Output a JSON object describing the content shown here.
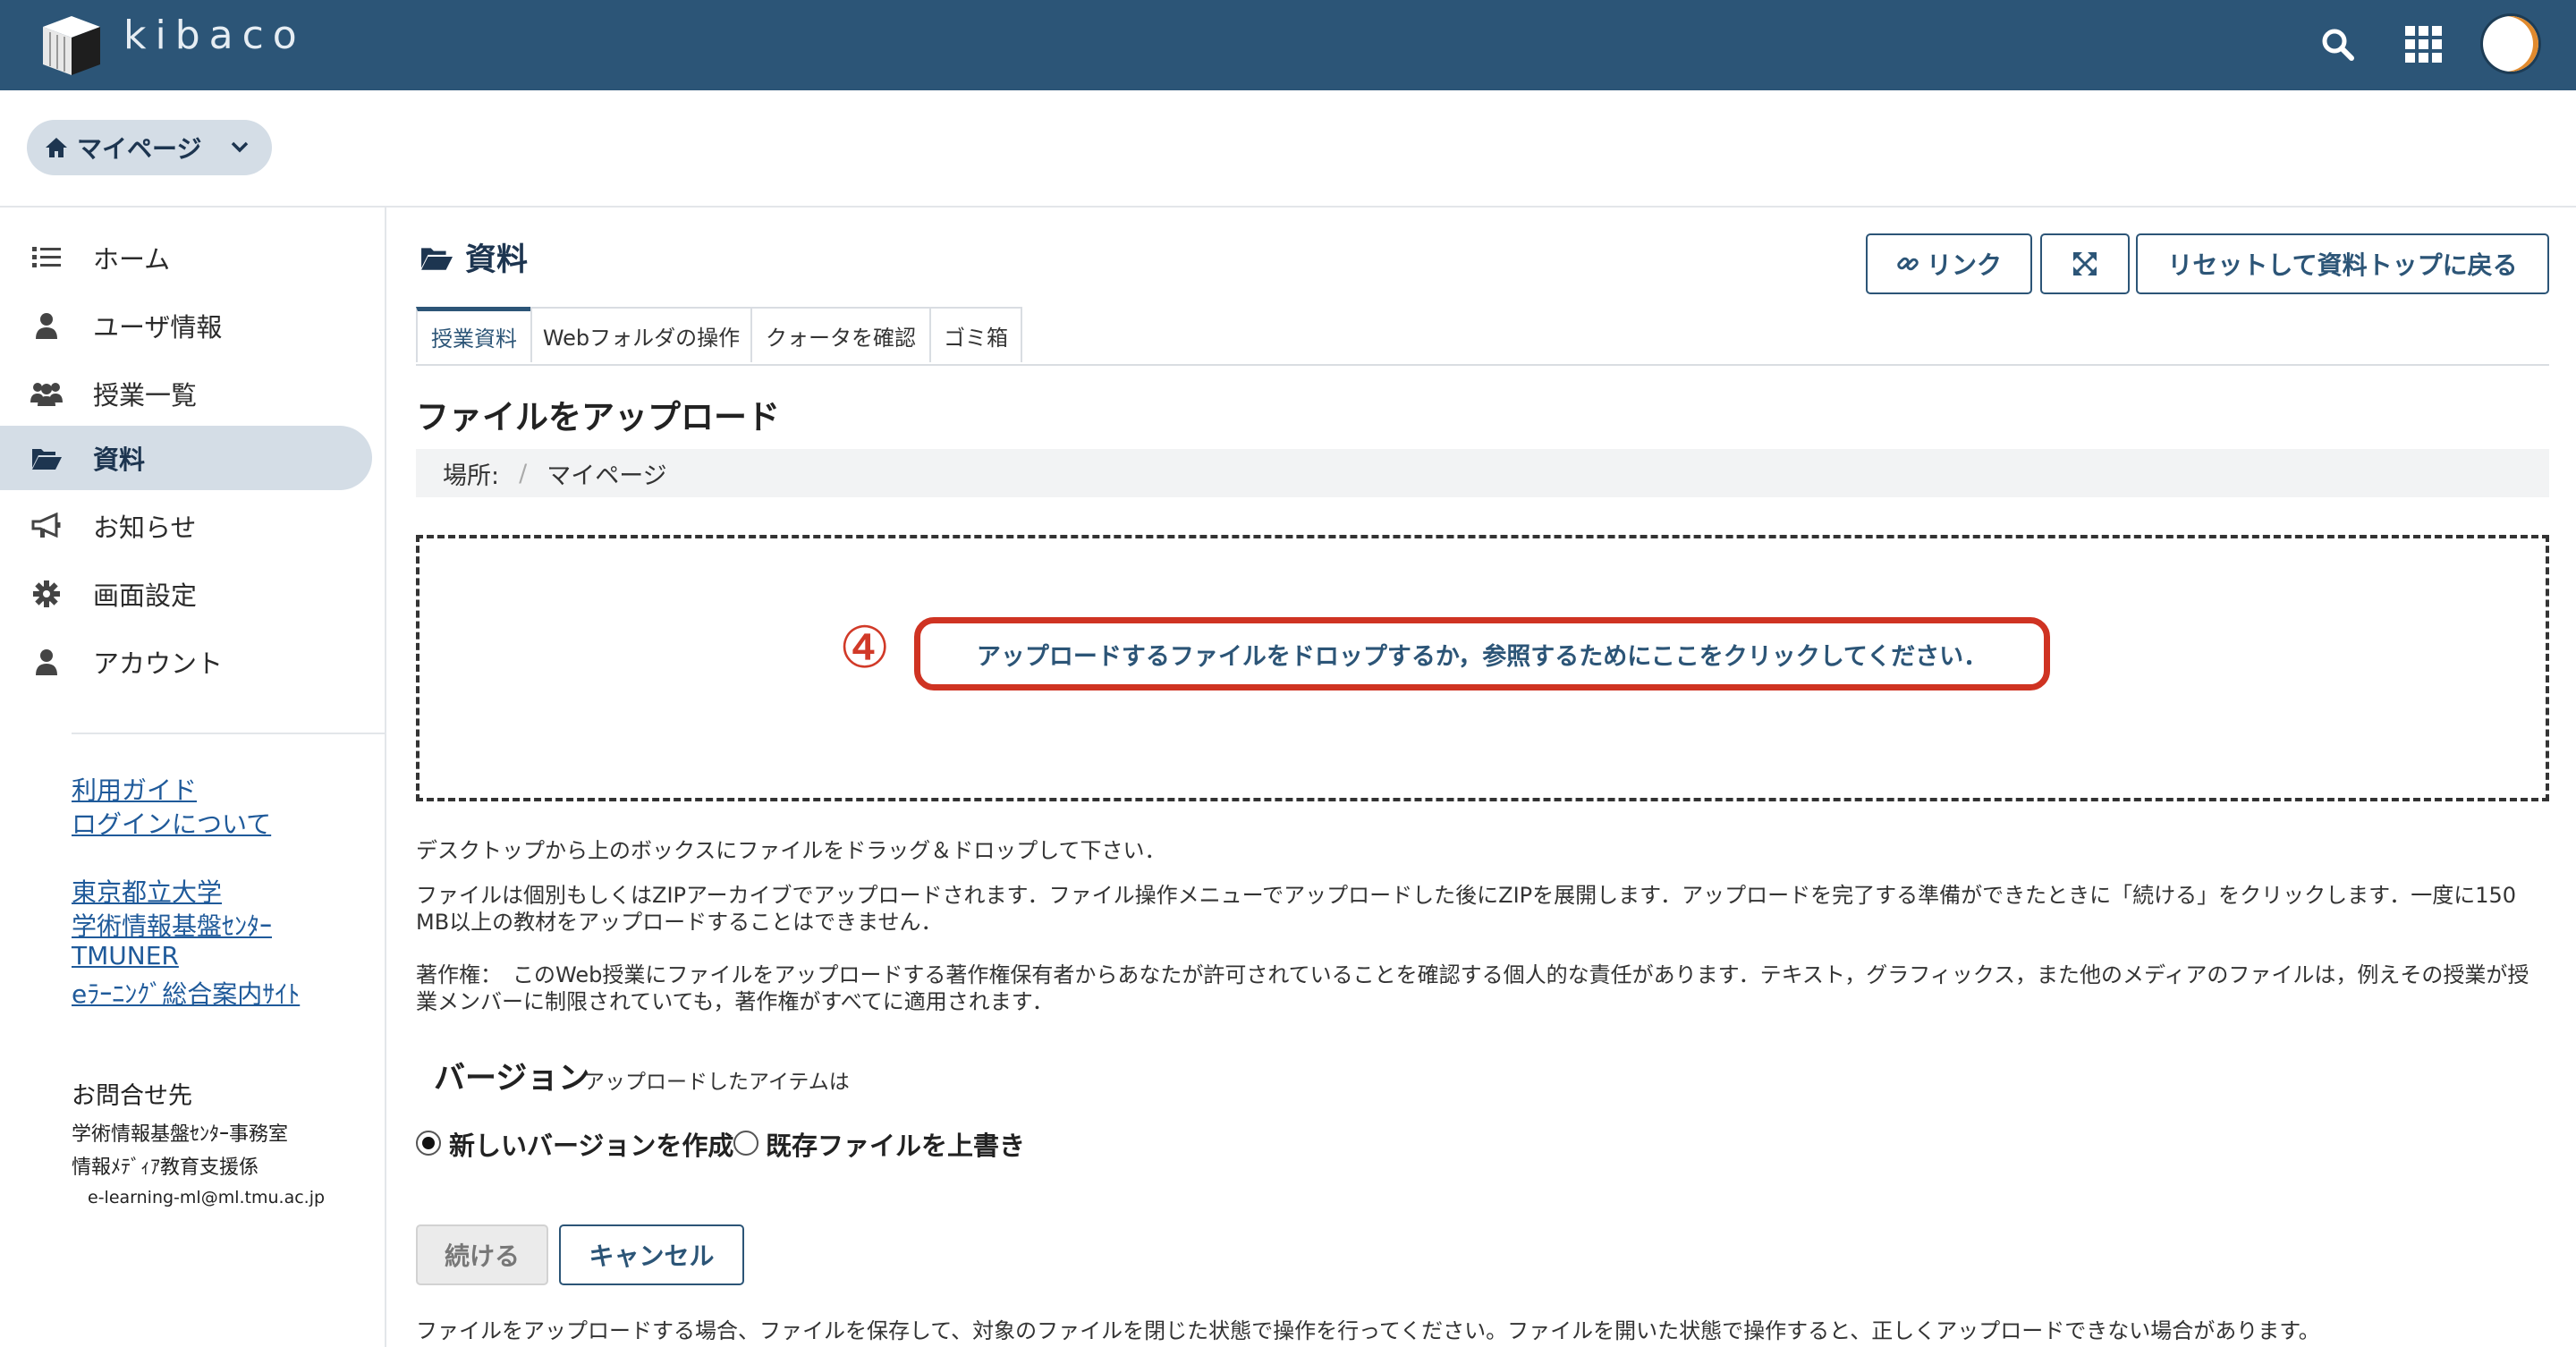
{
  "app": {
    "logo_text": "kibaco"
  },
  "topbar": {
    "search_icon": "search-icon",
    "apps_icon": "grid-icon",
    "avatar": "avatar"
  },
  "mypage": {
    "label": "マイページ"
  },
  "sidebar": {
    "items": [
      {
        "label": "ホーム",
        "icon": "list-icon"
      },
      {
        "label": "ユーザ情報",
        "icon": "user-icon"
      },
      {
        "label": "授業一覧",
        "icon": "users-icon"
      },
      {
        "label": "資料",
        "icon": "folder-open-icon",
        "active": true
      },
      {
        "label": "お知らせ",
        "icon": "megaphone-icon"
      },
      {
        "label": "画面設定",
        "icon": "gear-icon"
      },
      {
        "label": "アカウント",
        "icon": "user-icon"
      }
    ],
    "links1": [
      "利用ガイド",
      "ログインについて"
    ],
    "links2": [
      "東京都立大学",
      "学術情報基盤ｾﾝﾀｰ",
      "TMUNER",
      "eﾗｰﾆﾝｸﾞ総合案内ｻｲﾄ"
    ],
    "contact": {
      "title": "お問合せ先",
      "line1": "学術情報基盤ｾﾝﾀｰ事務室",
      "line2": "情報ﾒﾃﾞｨｱ教育支援係",
      "email": "e-learning-ml@ml.tmu.ac.jp"
    }
  },
  "main": {
    "title": "資料",
    "buttons": {
      "link": "リンク",
      "expand_icon": "expand-icon",
      "reset": "リセットして資料トップに戻る"
    },
    "tabs": [
      "授業資料",
      "Webフォルダの操作",
      "クォータを確認",
      "ゴミ箱"
    ],
    "upload_title": "ファイルをアップロード",
    "breadcrumb": {
      "label": "場所:",
      "sep": "/",
      "current": "マイページ"
    },
    "step_marker": "④",
    "drop_message": "アップロードするファイルをドロップするか，参照するためにここをクリックしてください．",
    "para1": "デスクトップから上のボックスにファイルをドラッグ＆ドロップして下さい．",
    "para2": "ファイルは個別もしくはZIPアーカイブでアップロードされます．ファイル操作メニューでアップロードした後にZIPを展開します．アップロードを完了する準備ができたときに「続ける」をクリックします．一度に150 MB以上の教材をアップロードすることはできません．",
    "para3": "著作権：　このWeb授業にファイルをアップロードする著作権保有者からあなたが許可されていることを確認する個人的な責任があります．テキスト，グラフィックス，また他のメディアのファイルは，例えその授業が授業メンバーに制限されていても，著作権がすべてに適用されます．",
    "version": {
      "title": "バージョン",
      "subtitle": "アップロードしたアイテムは",
      "options": [
        "新しいバージョンを作成",
        "既存ファイルを上書き"
      ],
      "selected": 0
    },
    "actions": {
      "continue": "続ける",
      "cancel": "キャンセル"
    },
    "note": "ファイルをアップロードする場合、ファイルを保存して、対象のファイルを閉じた状態で操作を行ってください。ファイルを開いた状態で操作すると、正しくアップロードできない場合があります。"
  },
  "colors": {
    "topbar": "#2c5577",
    "accent": "#2c5577",
    "highlight": "#cf3322",
    "active_nav": "#d4dde6"
  }
}
